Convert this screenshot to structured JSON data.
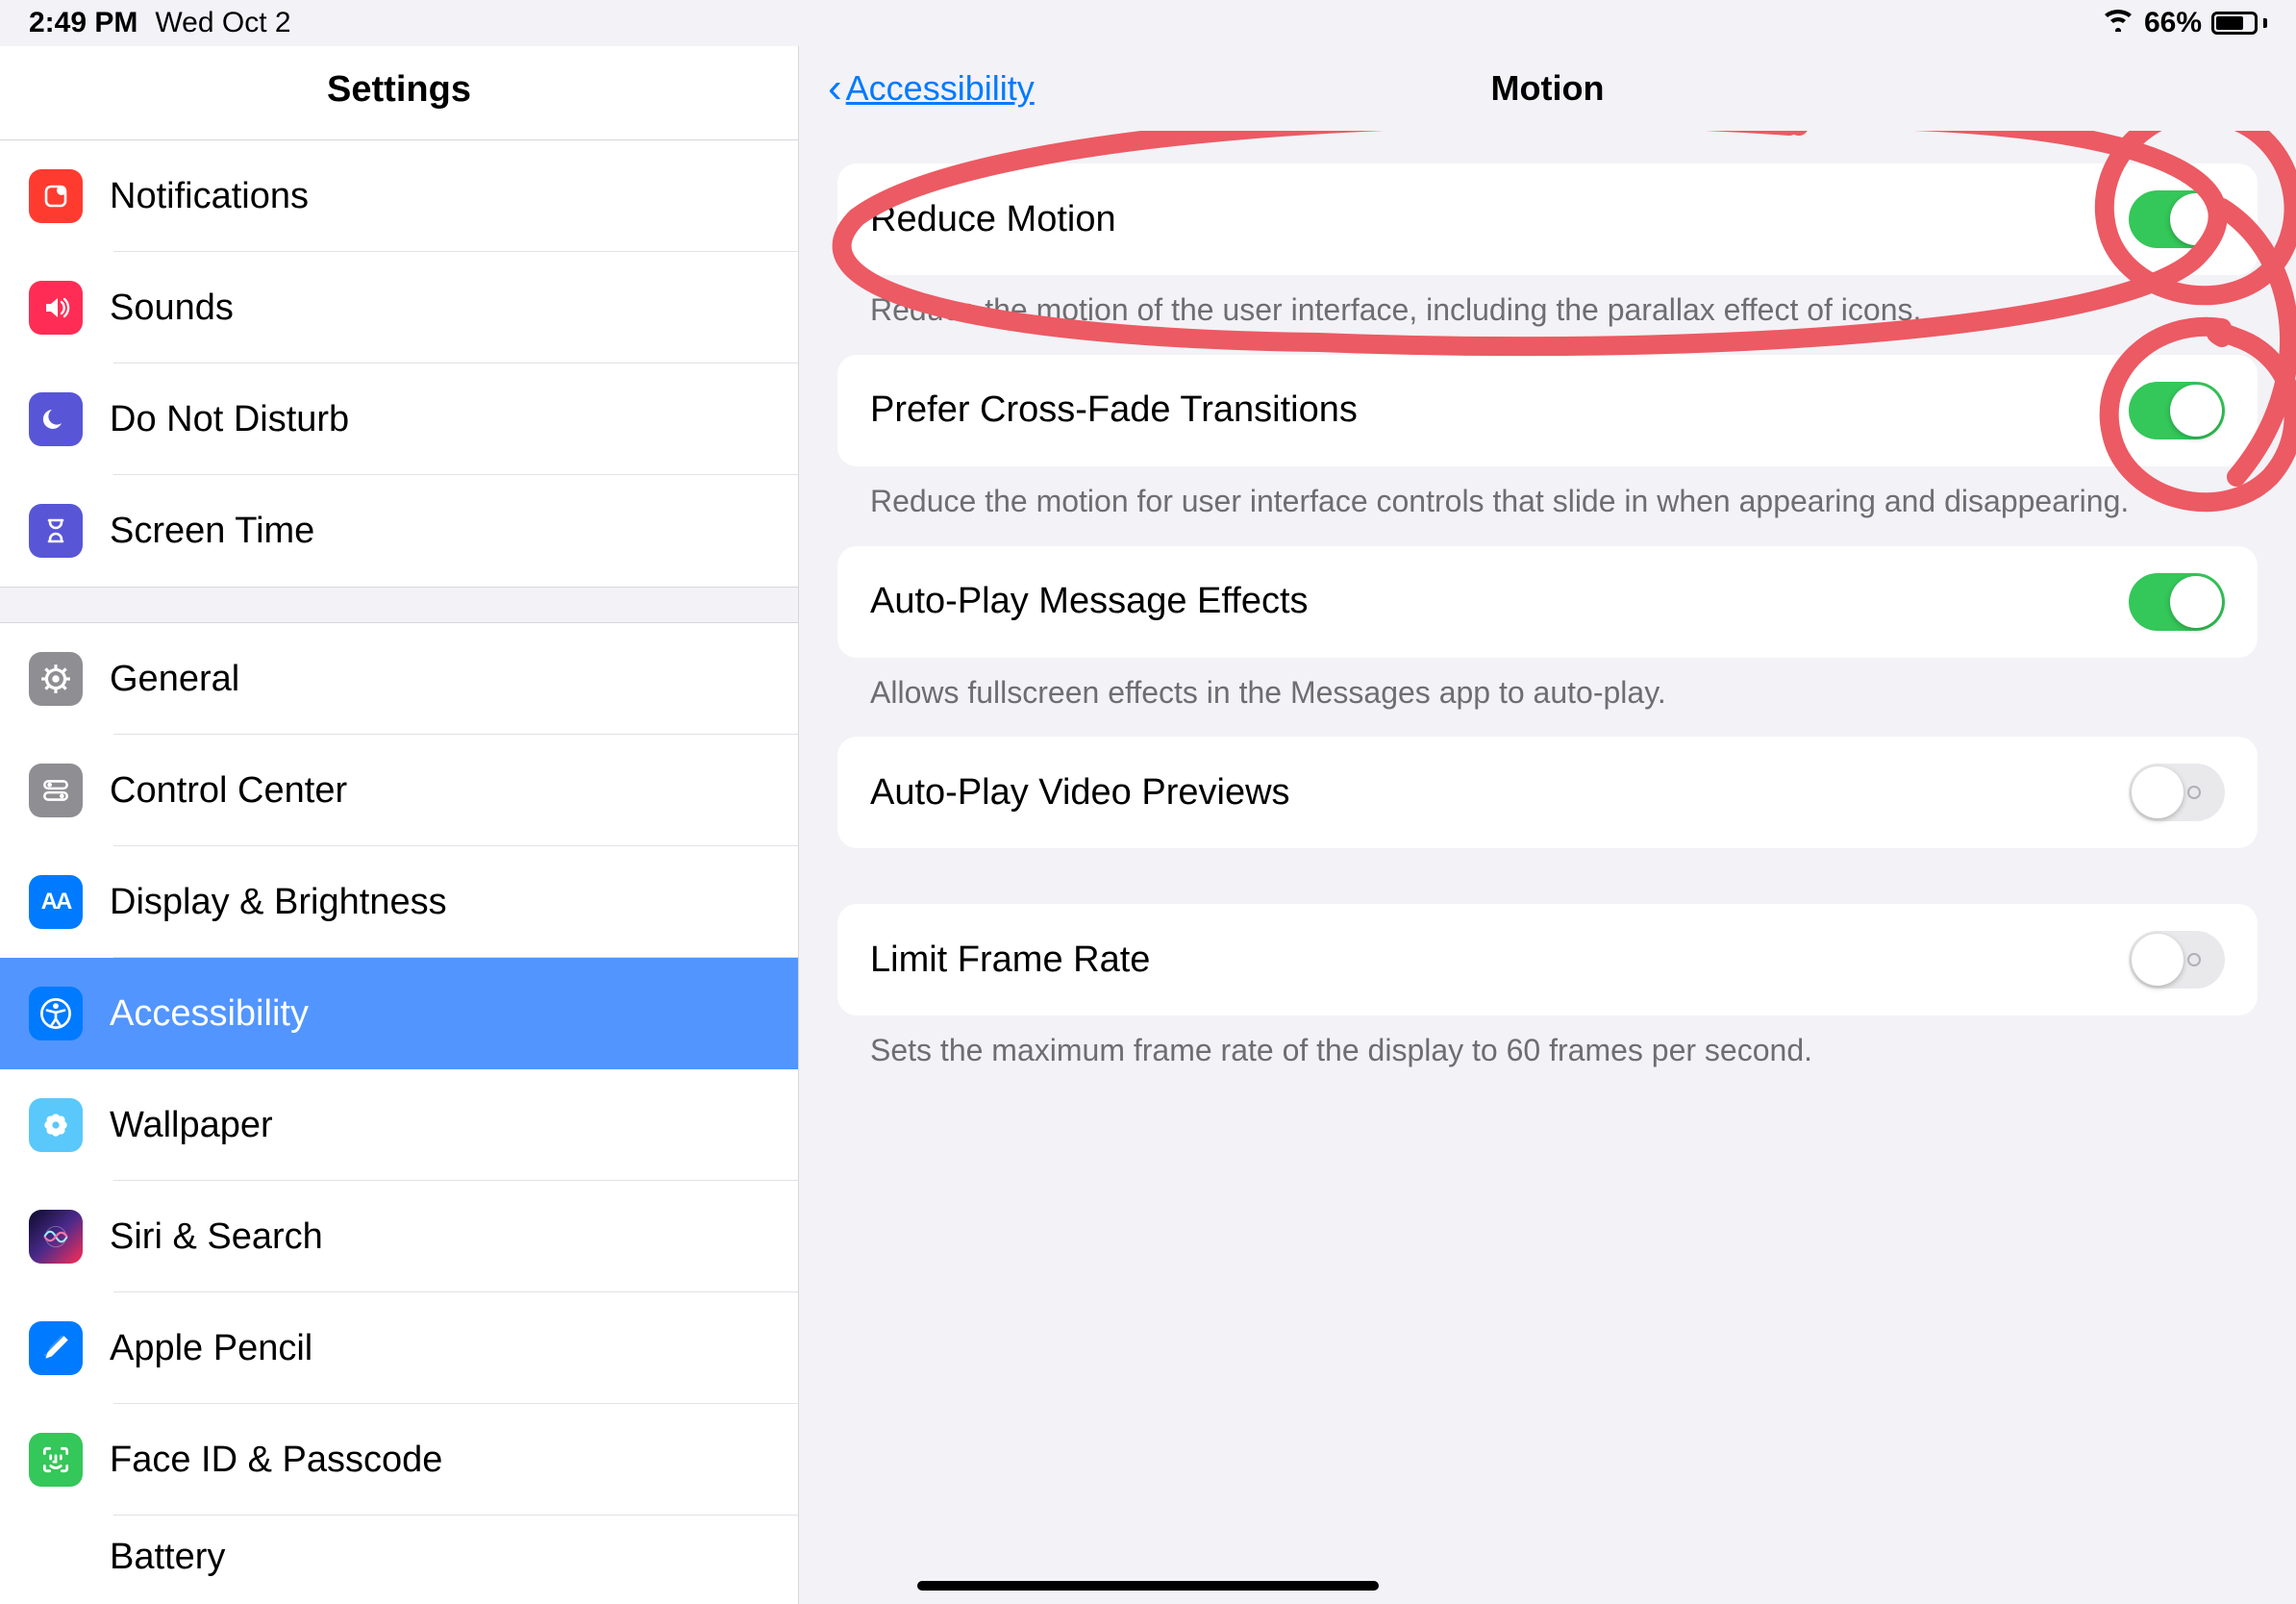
{
  "status": {
    "time": "2:49 PM",
    "date": "Wed Oct 2",
    "battery_pct": "66%"
  },
  "sidebar": {
    "title": "Settings",
    "group1": [
      {
        "label": "Notifications"
      },
      {
        "label": "Sounds"
      },
      {
        "label": "Do Not Disturb"
      },
      {
        "label": "Screen Time"
      }
    ],
    "group2": [
      {
        "label": "General"
      },
      {
        "label": "Control Center"
      },
      {
        "label": "Display & Brightness"
      },
      {
        "label": "Accessibility"
      },
      {
        "label": "Wallpaper"
      },
      {
        "label": "Siri & Search"
      },
      {
        "label": "Apple Pencil"
      },
      {
        "label": "Face ID & Passcode"
      },
      {
        "label": "Battery"
      }
    ]
  },
  "content": {
    "back_label": "Accessibility",
    "title": "Motion",
    "rows": [
      {
        "label": "Reduce Motion",
        "on": true,
        "caption": "Reduce the motion of the user interface, including the parallax effect of icons."
      },
      {
        "label": "Prefer Cross-Fade Transitions",
        "on": true,
        "caption": "Reduce the motion for user interface controls that slide in when appearing and disappearing."
      },
      {
        "label": "Auto-Play Message Effects",
        "on": true,
        "caption": "Allows fullscreen effects in the Messages app to auto-play."
      },
      {
        "label": "Auto-Play Video Previews",
        "on": false,
        "caption": ""
      },
      {
        "label": "Limit Frame Rate",
        "on": false,
        "caption": "Sets the maximum frame rate of the display to 60 frames per second."
      }
    ]
  }
}
